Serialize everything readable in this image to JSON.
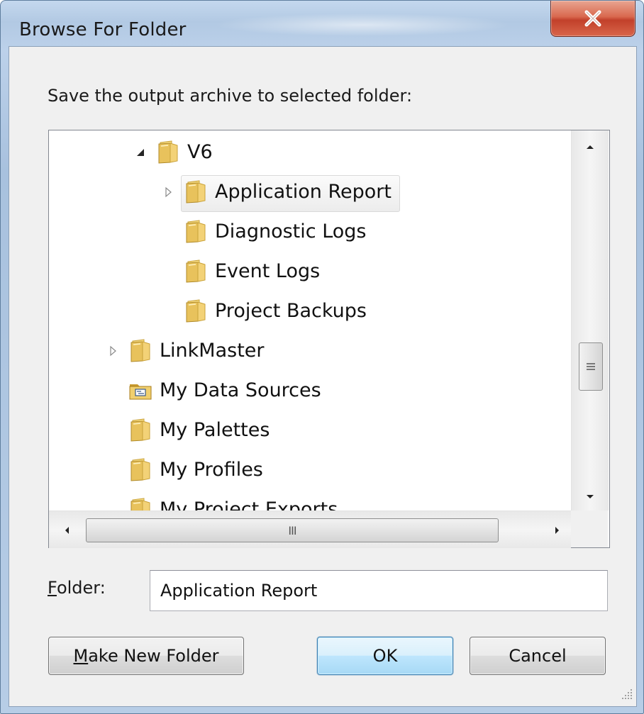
{
  "window": {
    "title": "Browse For Folder",
    "close_glyph": "X"
  },
  "prompt": "Save the output archive to selected folder:",
  "tree": {
    "items": [
      {
        "label": "V6",
        "indent": 2,
        "expander": "expanded",
        "icon": "folder-icon",
        "selected": false
      },
      {
        "label": "Application Report",
        "indent": 3,
        "expander": "collapsed",
        "icon": "folder-icon",
        "selected": true
      },
      {
        "label": "Diagnostic Logs",
        "indent": 3,
        "expander": "none",
        "icon": "folder-icon",
        "selected": false
      },
      {
        "label": "Event Logs",
        "indent": 3,
        "expander": "none",
        "icon": "folder-icon",
        "selected": false
      },
      {
        "label": "Project Backups",
        "indent": 3,
        "expander": "none",
        "icon": "folder-icon",
        "selected": false
      },
      {
        "label": "LinkMaster",
        "indent": 1,
        "expander": "collapsed",
        "icon": "folder-icon",
        "selected": false
      },
      {
        "label": "My Data Sources",
        "indent": 1,
        "expander": "none",
        "icon": "data-sources-folder-icon",
        "selected": false
      },
      {
        "label": "My Palettes",
        "indent": 1,
        "expander": "none",
        "icon": "folder-icon",
        "selected": false
      },
      {
        "label": "My Profiles",
        "indent": 1,
        "expander": "none",
        "icon": "folder-icon",
        "selected": false
      },
      {
        "label": "My Project Exports",
        "indent": 1,
        "expander": "none",
        "icon": "folder-icon",
        "selected": false
      }
    ]
  },
  "folder_field": {
    "label_prefix": "F",
    "label_rest": "older:",
    "value": "Application Report"
  },
  "buttons": {
    "make_new_folder_prefix": "M",
    "make_new_folder_rest": "ake New Folder",
    "ok": "OK",
    "cancel": "Cancel"
  },
  "scrollbar_thumb_glyph_h": "III",
  "colors": {
    "folder": "#e8c25c",
    "close_button": "#c94a32",
    "default_button_border": "#3c7fb1"
  }
}
